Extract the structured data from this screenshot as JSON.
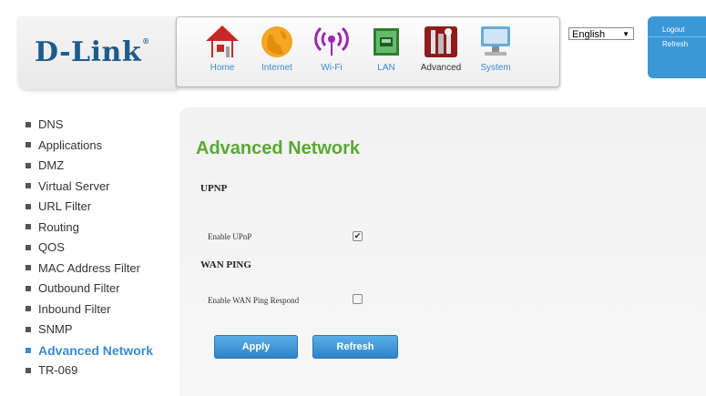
{
  "brand": {
    "name": "D-Link",
    "mark": "®",
    "color": "#1f5b8a"
  },
  "nav": {
    "items": [
      {
        "label": "Home",
        "icon": "home-icon"
      },
      {
        "label": "Internet",
        "icon": "globe-icon"
      },
      {
        "label": "Wi-Fi",
        "icon": "wifi-signal-icon"
      },
      {
        "label": "LAN",
        "icon": "lan-port-icon"
      },
      {
        "label": "Advanced",
        "icon": "tools-icon",
        "active": true
      },
      {
        "label": "System",
        "icon": "monitor-icon"
      }
    ]
  },
  "language": {
    "selected": "English"
  },
  "side_buttons": {
    "logout": "Logout",
    "refresh": "Refresh"
  },
  "sidebar": {
    "items": [
      {
        "label": "DNS"
      },
      {
        "label": "Applications"
      },
      {
        "label": "DMZ"
      },
      {
        "label": "Virtual Server"
      },
      {
        "label": "URL Filter"
      },
      {
        "label": "Routing"
      },
      {
        "label": "QOS"
      },
      {
        "label": "MAC Address Filter"
      },
      {
        "label": "Outbound Filter"
      },
      {
        "label": "Inbound Filter"
      },
      {
        "label": "SNMP"
      },
      {
        "label": "Advanced Network",
        "active": true
      },
      {
        "label": "TR-069"
      }
    ]
  },
  "main": {
    "title": "Advanced Network",
    "upnp": {
      "heading": "UPNP",
      "label": "Enable UPnP",
      "checked": true
    },
    "wan_ping": {
      "heading": "WAN PING",
      "label": "Enable WAN Ping Respond",
      "checked": false
    },
    "apply_label": "Apply",
    "refresh_label": "Refresh"
  },
  "colors": {
    "accent": "#3d8bd1",
    "title": "#5aa833",
    "button": "#2e84c9"
  }
}
